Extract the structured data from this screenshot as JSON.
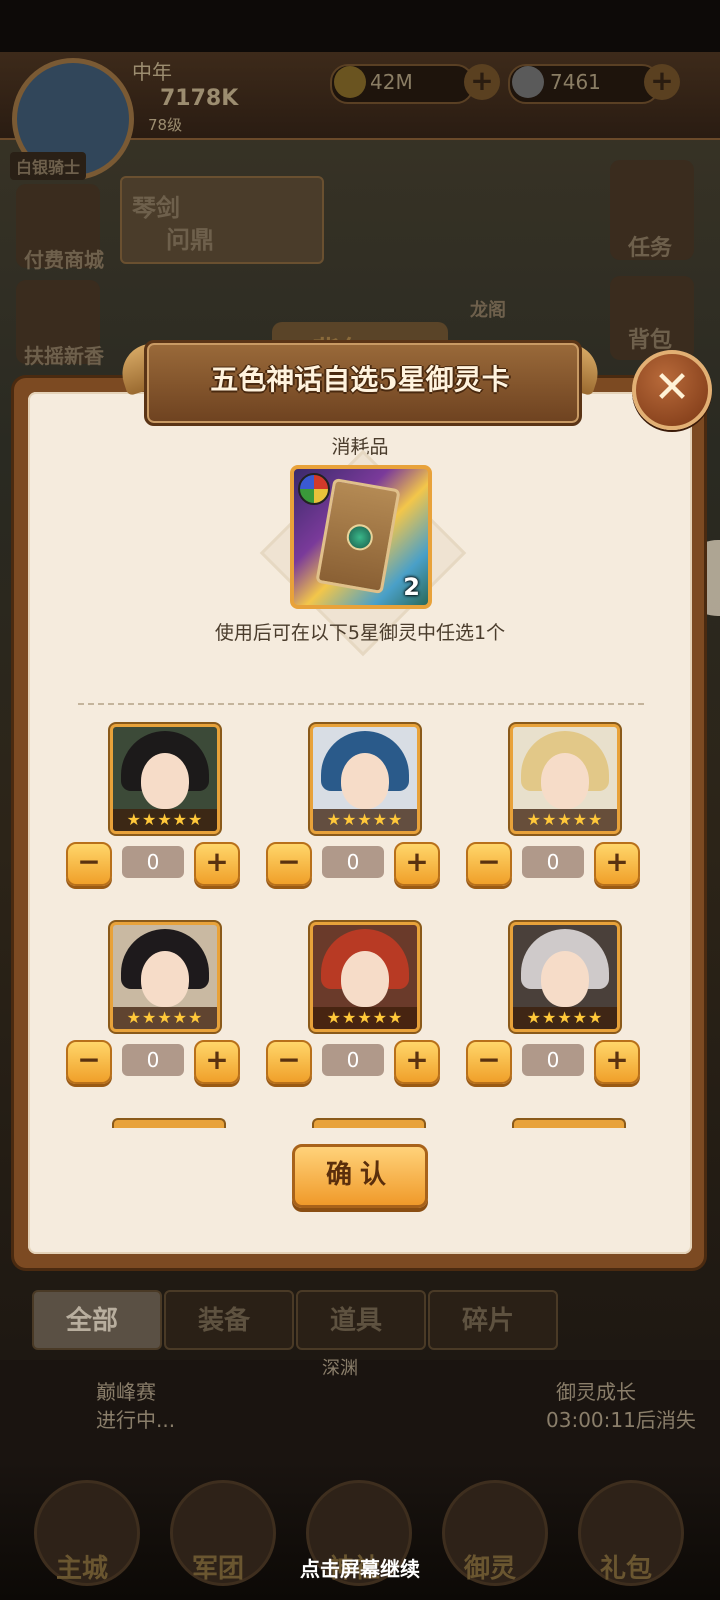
{
  "background": {
    "player": {
      "name": "中年",
      "power": "7178K",
      "level": "78级"
    },
    "resources": [
      {
        "value": "42M"
      },
      {
        "value": "7461"
      }
    ],
    "left_menu": [
      {
        "label": "白银骑士"
      },
      {
        "label": "付费商城"
      },
      {
        "label": "扶摇新香"
      }
    ],
    "right_menu": [
      {
        "label": "任务"
      },
      {
        "label": "背包"
      }
    ],
    "banner": {
      "line1": "琴剑",
      "line2": "问鼎"
    },
    "scene_tag": "龙阁",
    "bag_title": "背包",
    "tabs": [
      {
        "label": "全部"
      },
      {
        "label": "装备"
      },
      {
        "label": "道具"
      },
      {
        "label": "碎片"
      }
    ],
    "sub_tag": "深渊",
    "events": {
      "left": {
        "title": "巅峰赛",
        "status": "进行中..."
      },
      "right": {
        "title": "御灵成长",
        "timer": "03:00:11后消失"
      }
    },
    "bottom_nav": [
      {
        "label": "主城"
      },
      {
        "label": "军团"
      },
      {
        "label": "神社"
      },
      {
        "label": "御灵"
      },
      {
        "label": "礼包"
      }
    ],
    "continue_hint": "点击屏幕继续"
  },
  "dialog": {
    "title": "五色神话自选5星御灵卡",
    "close_icon": "close-icon",
    "category": "消耗品",
    "item": {
      "count": "2"
    },
    "description": "使用后可在以下5星御灵中任选1个",
    "heroes": [
      {
        "stars": "★★★★★",
        "qty": "0",
        "minus": "−",
        "plus": "+",
        "hair": "#1c1a1a"
      },
      {
        "stars": "★★★★★",
        "qty": "0",
        "minus": "−",
        "plus": "+",
        "hair": "#2a5a8a"
      },
      {
        "stars": "★★★★★",
        "qty": "0",
        "minus": "−",
        "plus": "+",
        "hair": "#e2c888"
      },
      {
        "stars": "★★★★★",
        "qty": "0",
        "minus": "−",
        "plus": "+",
        "hair": "#1e1a1c"
      },
      {
        "stars": "★★★★★",
        "qty": "0",
        "minus": "−",
        "plus": "+",
        "hair": "#b83a24"
      },
      {
        "stars": "★★★★★",
        "qty": "0",
        "minus": "−",
        "plus": "+",
        "hair": "#cfcaca"
      }
    ],
    "confirm_label": "确认"
  }
}
